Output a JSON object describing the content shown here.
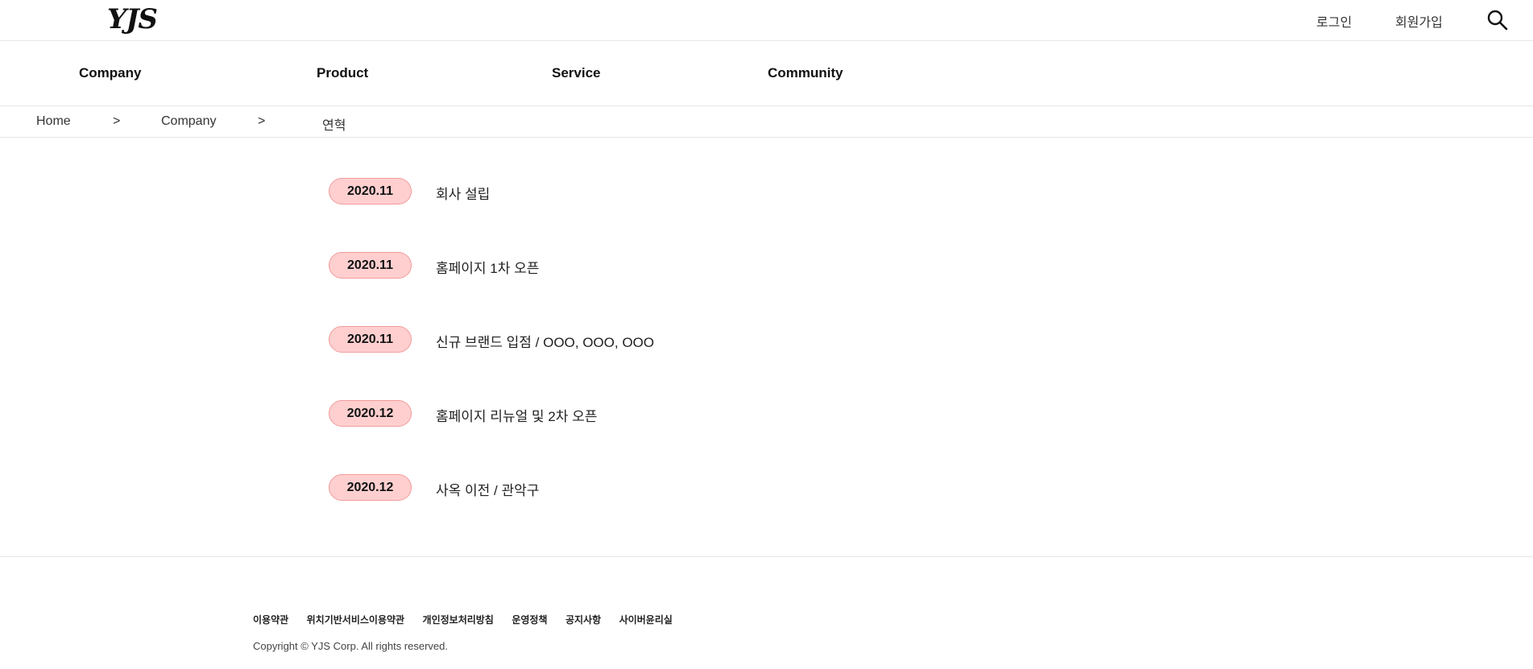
{
  "header": {
    "logo_text": "YJS",
    "login_label": "로그인",
    "signup_label": "회원가입",
    "search_icon": "search-icon"
  },
  "nav": {
    "items": [
      {
        "label": "Company"
      },
      {
        "label": "Product"
      },
      {
        "label": "Service"
      },
      {
        "label": "Community"
      }
    ]
  },
  "breadcrumb": {
    "home": "Home",
    "separator": ">",
    "section": "Company",
    "current": "연혁"
  },
  "timeline": {
    "items": [
      {
        "date": "2020.11",
        "text": "회사 설립"
      },
      {
        "date": "2020.11",
        "text": "홈페이지 1차 오픈"
      },
      {
        "date": "2020.11",
        "text": "신규 브랜드 입점 / OOO, OOO, OOO"
      },
      {
        "date": "2020.12",
        "text": "홈페이지 리뉴얼 및 2차 오픈"
      },
      {
        "date": "2020.12",
        "text": "사옥 이전 / 관악구"
      }
    ],
    "badge_fill": "#ffcfcf",
    "badge_border": "#f29b9b"
  },
  "footer": {
    "links": [
      {
        "label": "이용약관"
      },
      {
        "label": "위치기반서비스이용약관"
      },
      {
        "label": "개인정보처리방침"
      },
      {
        "label": "운영정책"
      },
      {
        "label": "공지사항"
      },
      {
        "label": "사이버윤리실"
      }
    ],
    "copyright": "Copyright © YJS Corp. All rights reserved."
  }
}
